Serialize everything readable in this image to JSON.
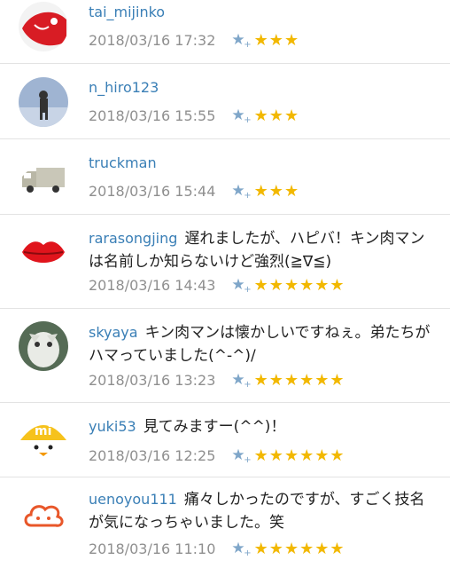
{
  "comments": [
    {
      "user": "tai_mijinko",
      "message": "",
      "date": "2018/03/16 17:32",
      "stars": "★★★",
      "avatar": "fish-red-icon"
    },
    {
      "user": "n_hiro123",
      "message": "",
      "date": "2018/03/16 15:55",
      "stars": "★★★",
      "avatar": "person-photo-icon"
    },
    {
      "user": "truckman",
      "message": "",
      "date": "2018/03/16 15:44",
      "stars": "★★★",
      "avatar": "truck-icon"
    },
    {
      "user": "rarasongjing",
      "message": "遅れましたが、ハピバ！キン肉マンは名前しか知らないけど強烈(≧∇≦)",
      "date": "2018/03/16 14:43",
      "stars": "★★★★★★",
      "avatar": "lips-icon"
    },
    {
      "user": "skyaya",
      "message": "キン肉マンは懐かしいですねぇ。弟たちがハマっていました(^-^)/",
      "date": "2018/03/16 13:23",
      "stars": "★★★★★★",
      "avatar": "cat-photo-icon"
    },
    {
      "user": "yuki53",
      "message": "見てみますー(^^)！",
      "date": "2018/03/16 12:25",
      "stars": "★★★★★★",
      "avatar": "mi-chick-icon"
    },
    {
      "user": "uenoyou111",
      "message": "痛々しかったのですが、すごく技名が気になっちゃいました。笑",
      "date": "2018/03/16 11:10",
      "stars": "★★★★★★",
      "avatar": "cloud-face-icon"
    }
  ],
  "icons": {
    "favorite_add": "star-plus-icon",
    "star_glyph": "★",
    "plus_glyph": "+"
  },
  "colors": {
    "username": "#3a7fb6",
    "star": "#f2b800",
    "date": "#8f8f8f",
    "divider": "#e3e3e3"
  }
}
